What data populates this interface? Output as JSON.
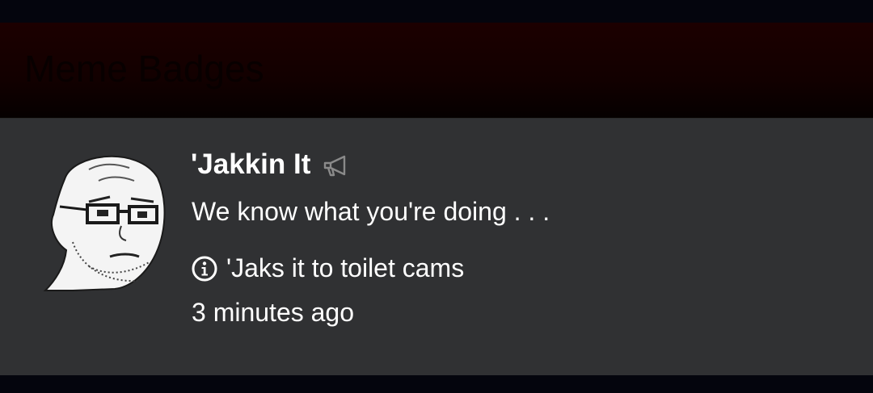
{
  "header": {
    "title": "Meme Badges"
  },
  "badge": {
    "icon": "wojak-glasses-face",
    "title": "'Jakkin It",
    "title_icon": "megaphone-icon",
    "description": "We know what you're doing . . .",
    "info_icon": "info-circle-icon",
    "info_text": "'Jaks it to toilet cams",
    "timestamp": "3 minutes ago"
  },
  "colors": {
    "page_background": "#04050d",
    "header_background": "#1c0000",
    "header_text": "#080000",
    "card_background": "#303133",
    "text": "#ffffff",
    "icon_muted": "#8a8a8a"
  }
}
